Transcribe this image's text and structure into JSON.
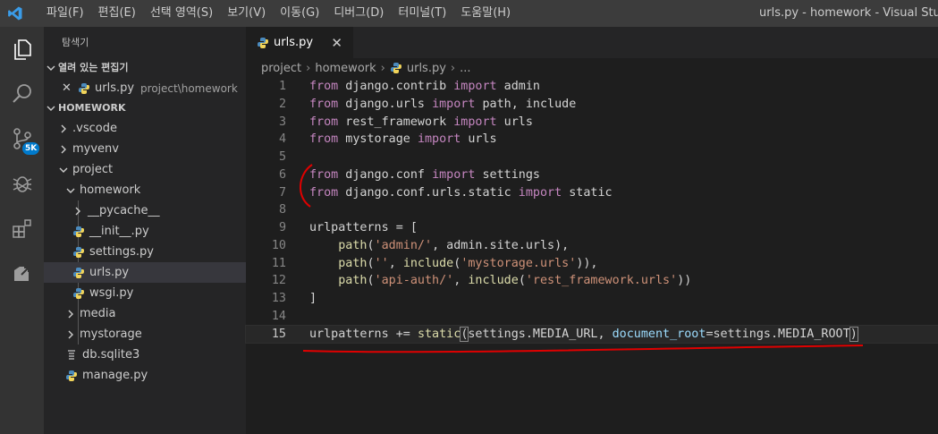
{
  "titlebar": {
    "menus": [
      "파일(F)",
      "편집(E)",
      "선택 영역(S)",
      "보기(V)",
      "이동(G)",
      "디버그(D)",
      "터미널(T)",
      "도움말(H)"
    ],
    "window_title": "urls.py - homework - Visual Studio C"
  },
  "activity_bar": {
    "source_control_badge": "5K"
  },
  "sidebar": {
    "title": "탐색기",
    "open_editors_header": "열려 있는 편집기",
    "open_editor": {
      "name": "urls.py",
      "path": "project\\homework"
    },
    "workspace_header": "HOMEWORK",
    "tree": {
      "vscode": ".vscode",
      "myvenv": "myvenv",
      "project": "project",
      "homework": "homework",
      "pycache": "__pycache__",
      "init": "__init__.py",
      "settings": "settings.py",
      "urls": "urls.py",
      "wsgi": "wsgi.py",
      "media": "media",
      "mystorage": "mystorage",
      "db": "db.sqlite3",
      "manage": "manage.py"
    }
  },
  "editor": {
    "tab_label": "urls.py",
    "breadcrumb": [
      "project",
      "homework",
      "urls.py",
      "..."
    ],
    "code": {
      "l1": [
        "from",
        " django.contrib ",
        "import",
        " admin"
      ],
      "l2": [
        "from",
        " django.urls ",
        "import",
        " path, include"
      ],
      "l3": [
        "from",
        " rest_framework ",
        "import",
        " urls"
      ],
      "l4": [
        "from",
        " mystorage ",
        "import",
        " urls"
      ],
      "l6": [
        "from",
        " django.conf ",
        "import",
        " settings"
      ],
      "l7": [
        "from",
        " django.conf.urls.static ",
        "import",
        " static"
      ],
      "l9": "urlpatterns = [",
      "l10": [
        "    ",
        "path",
        "(",
        "'admin/'",
        ", admin.site.urls),"
      ],
      "l11": [
        "    ",
        "path",
        "(",
        "''",
        ", ",
        "include",
        "(",
        "'mystorage.urls'",
        ")),"
      ],
      "l12": [
        "    ",
        "path",
        "(",
        "'api-auth/'",
        ", ",
        "include",
        "(",
        "'rest_framework.urls'",
        "))"
      ],
      "l13": "]",
      "l15": [
        "urlpatterns += ",
        "static",
        "(",
        "settings.MEDIA_URL, ",
        "document_root",
        "=settings.MEDIA_ROOT",
        ")"
      ]
    },
    "line_numbers": [
      "1",
      "2",
      "3",
      "4",
      "5",
      "6",
      "7",
      "8",
      "9",
      "10",
      "11",
      "12",
      "13",
      "14",
      "15"
    ]
  },
  "colors": {
    "annotation": "#e00000",
    "accent": "#007acc"
  }
}
